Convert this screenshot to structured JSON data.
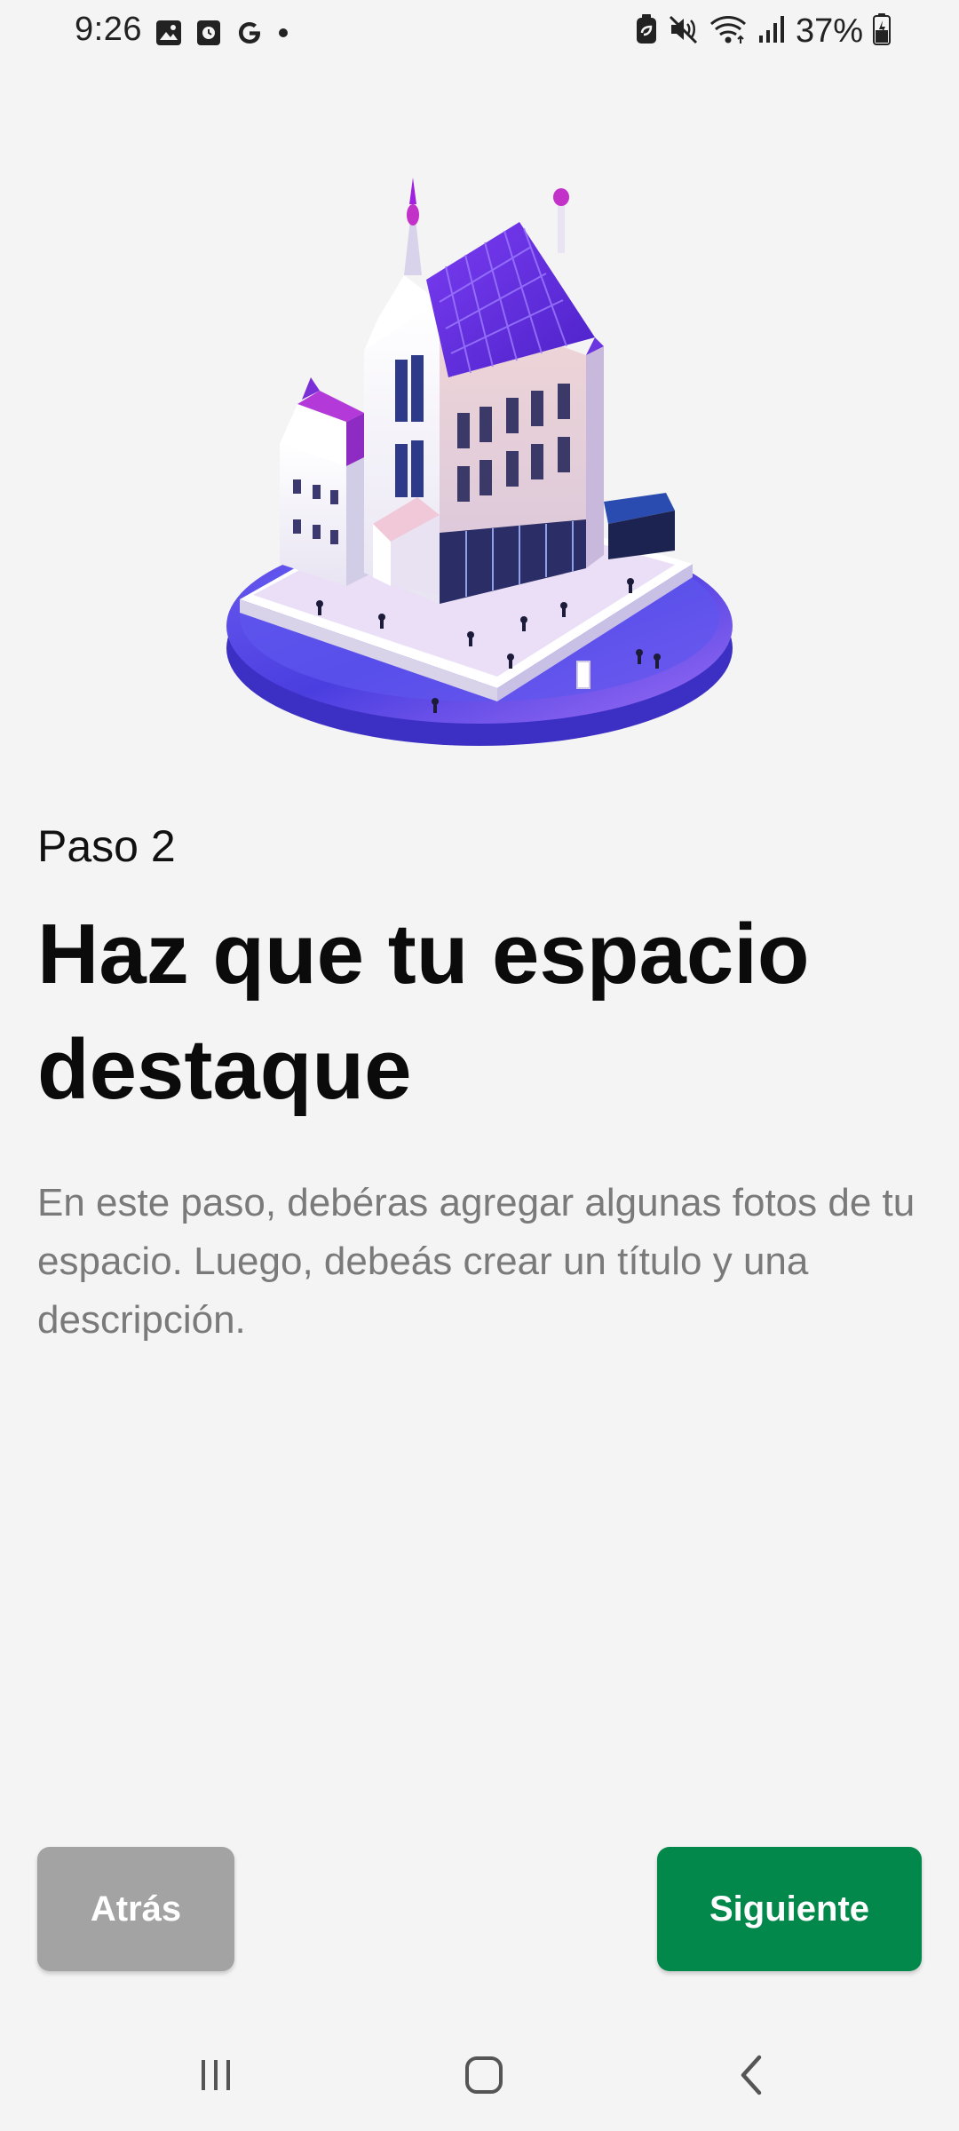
{
  "status_bar": {
    "time": "9:26",
    "battery": "37%",
    "left_icons": [
      "image-icon",
      "clock-app-icon",
      "google-icon",
      "dot-icon"
    ],
    "right_icons": [
      "battery-saver-icon",
      "mute-icon",
      "wifi-icon",
      "signal-icon",
      "battery-icon"
    ]
  },
  "content": {
    "step": "Paso 2",
    "title": "Haz que tu espacio destaque",
    "description": "En este paso, debéras agregar algunas fotos de tu espacio. Luego, debeás crear un título y una descripción."
  },
  "buttons": {
    "back_label": "Atrás",
    "next_label": "Siguiente"
  },
  "colors": {
    "background": "#f4f4f4",
    "back_button": "#a3a3a3",
    "next_button": "#02884a",
    "title_text": "#0b0b0b",
    "description_text": "#7a7a7a"
  },
  "nav_bar": {
    "buttons": [
      "recent-apps-icon",
      "home-icon",
      "back-icon"
    ]
  }
}
